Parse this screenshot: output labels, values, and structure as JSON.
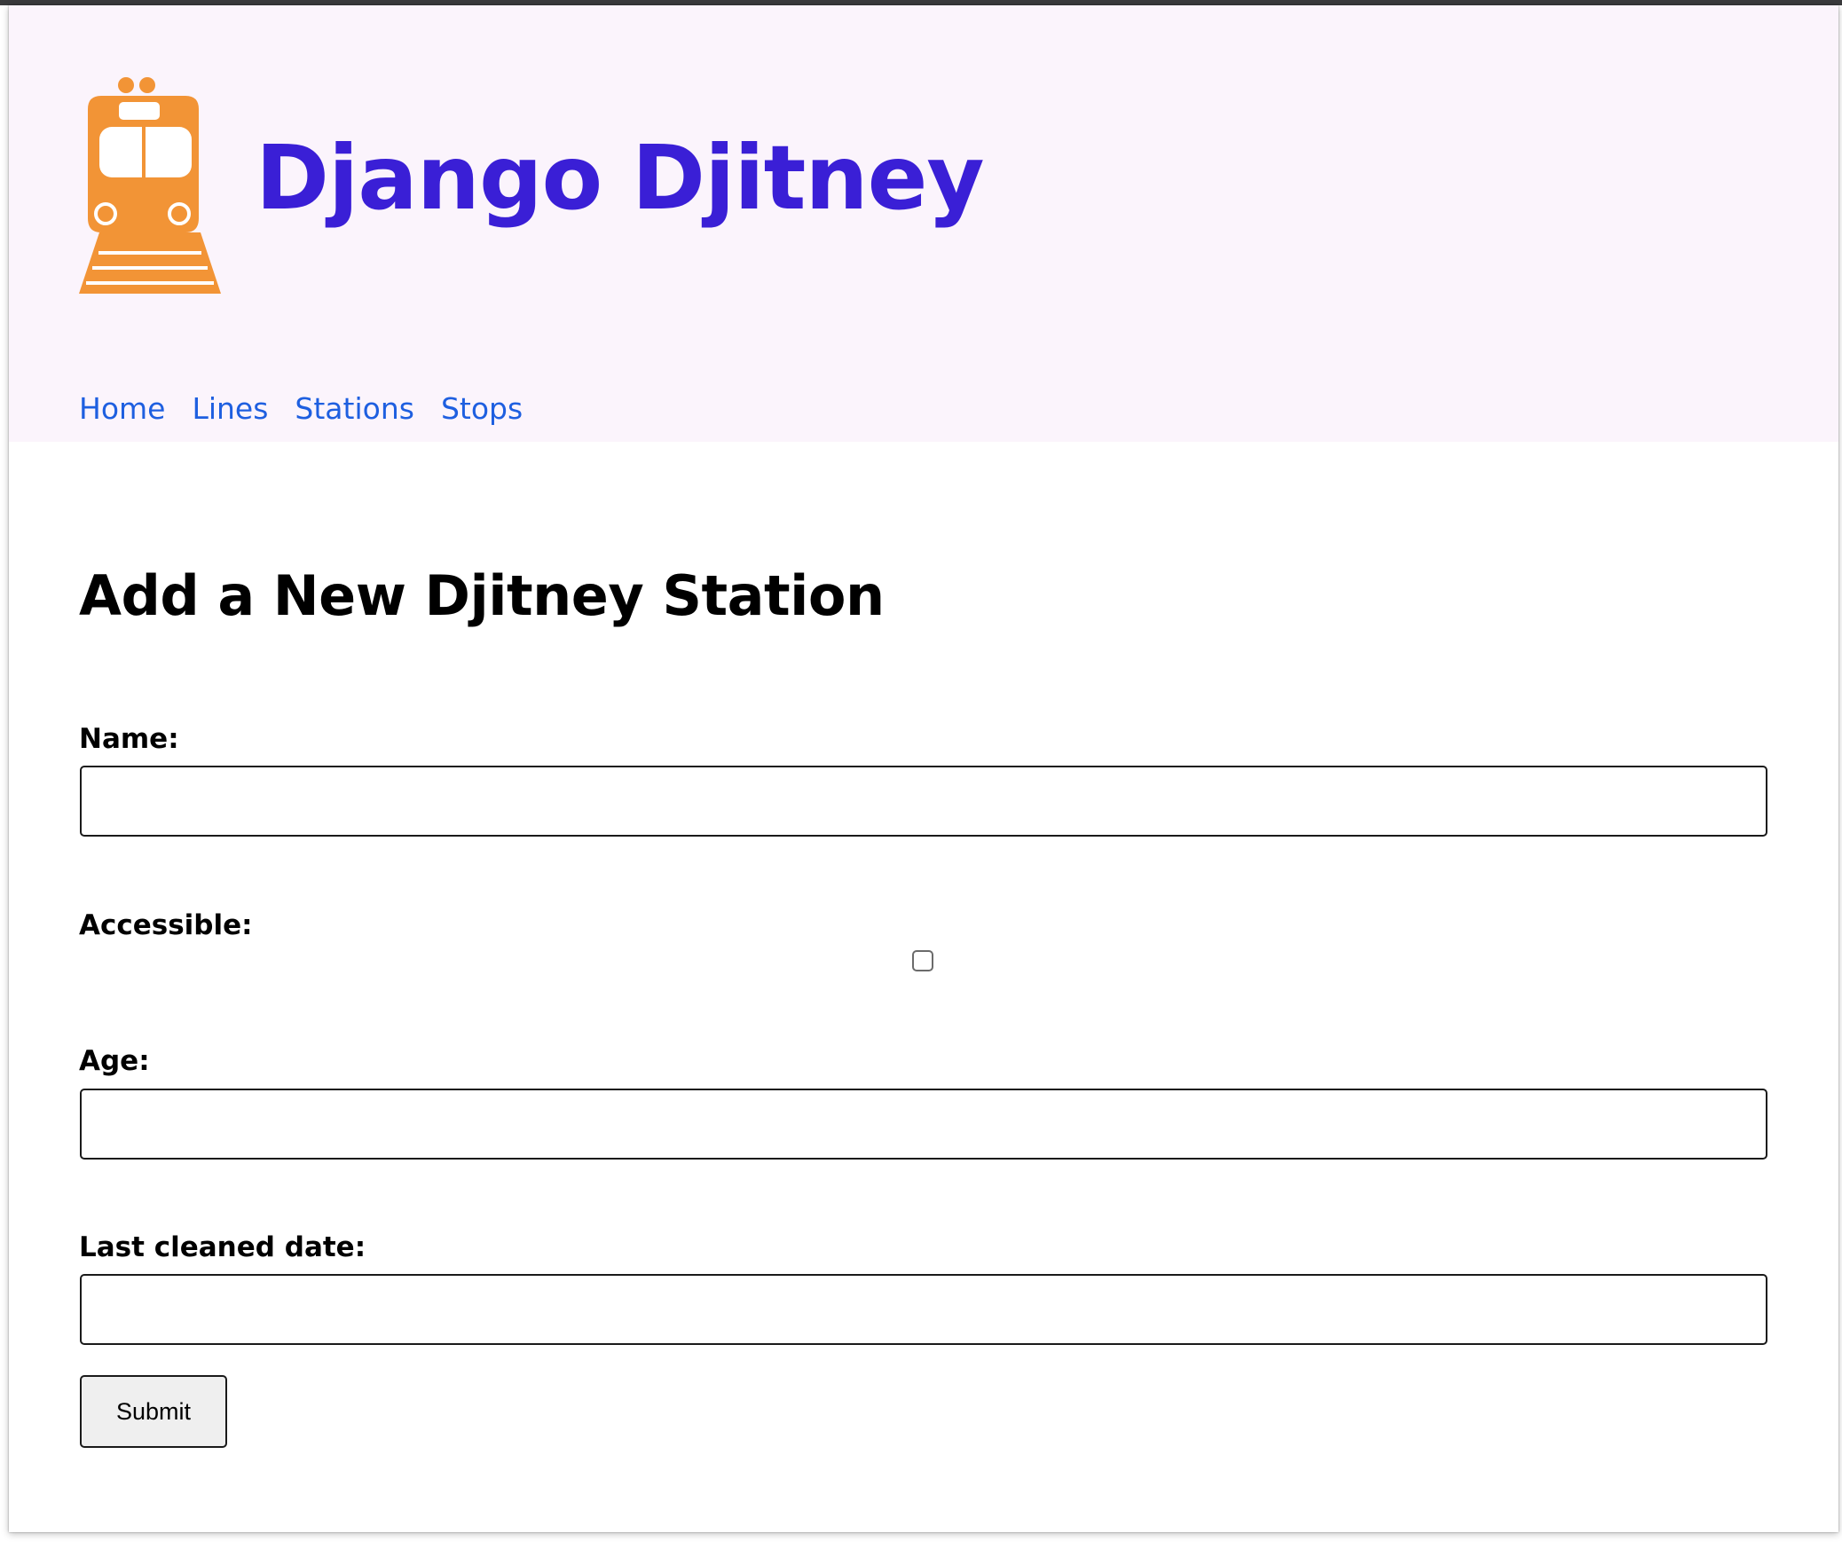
{
  "site": {
    "title": "Django Djitney",
    "logo_icon": "train-icon",
    "brand_color": "#3a1fd6",
    "logo_color": "#f29436",
    "header_bg": "#fbf4fc"
  },
  "nav": {
    "items": [
      {
        "label": "Home"
      },
      {
        "label": "Lines"
      },
      {
        "label": "Stations"
      },
      {
        "label": "Stops"
      }
    ],
    "link_color": "#1e5fe0"
  },
  "page": {
    "heading": "Add a New Djitney Station"
  },
  "form": {
    "name": {
      "label": "Name:",
      "value": "",
      "placeholder": ""
    },
    "accessible": {
      "label": "Accessible:",
      "checked": false
    },
    "age": {
      "label": "Age:",
      "value": "",
      "placeholder": ""
    },
    "last_cleaned_date": {
      "label": "Last cleaned date:",
      "value": "",
      "placeholder": ""
    },
    "submit_label": "Submit"
  }
}
